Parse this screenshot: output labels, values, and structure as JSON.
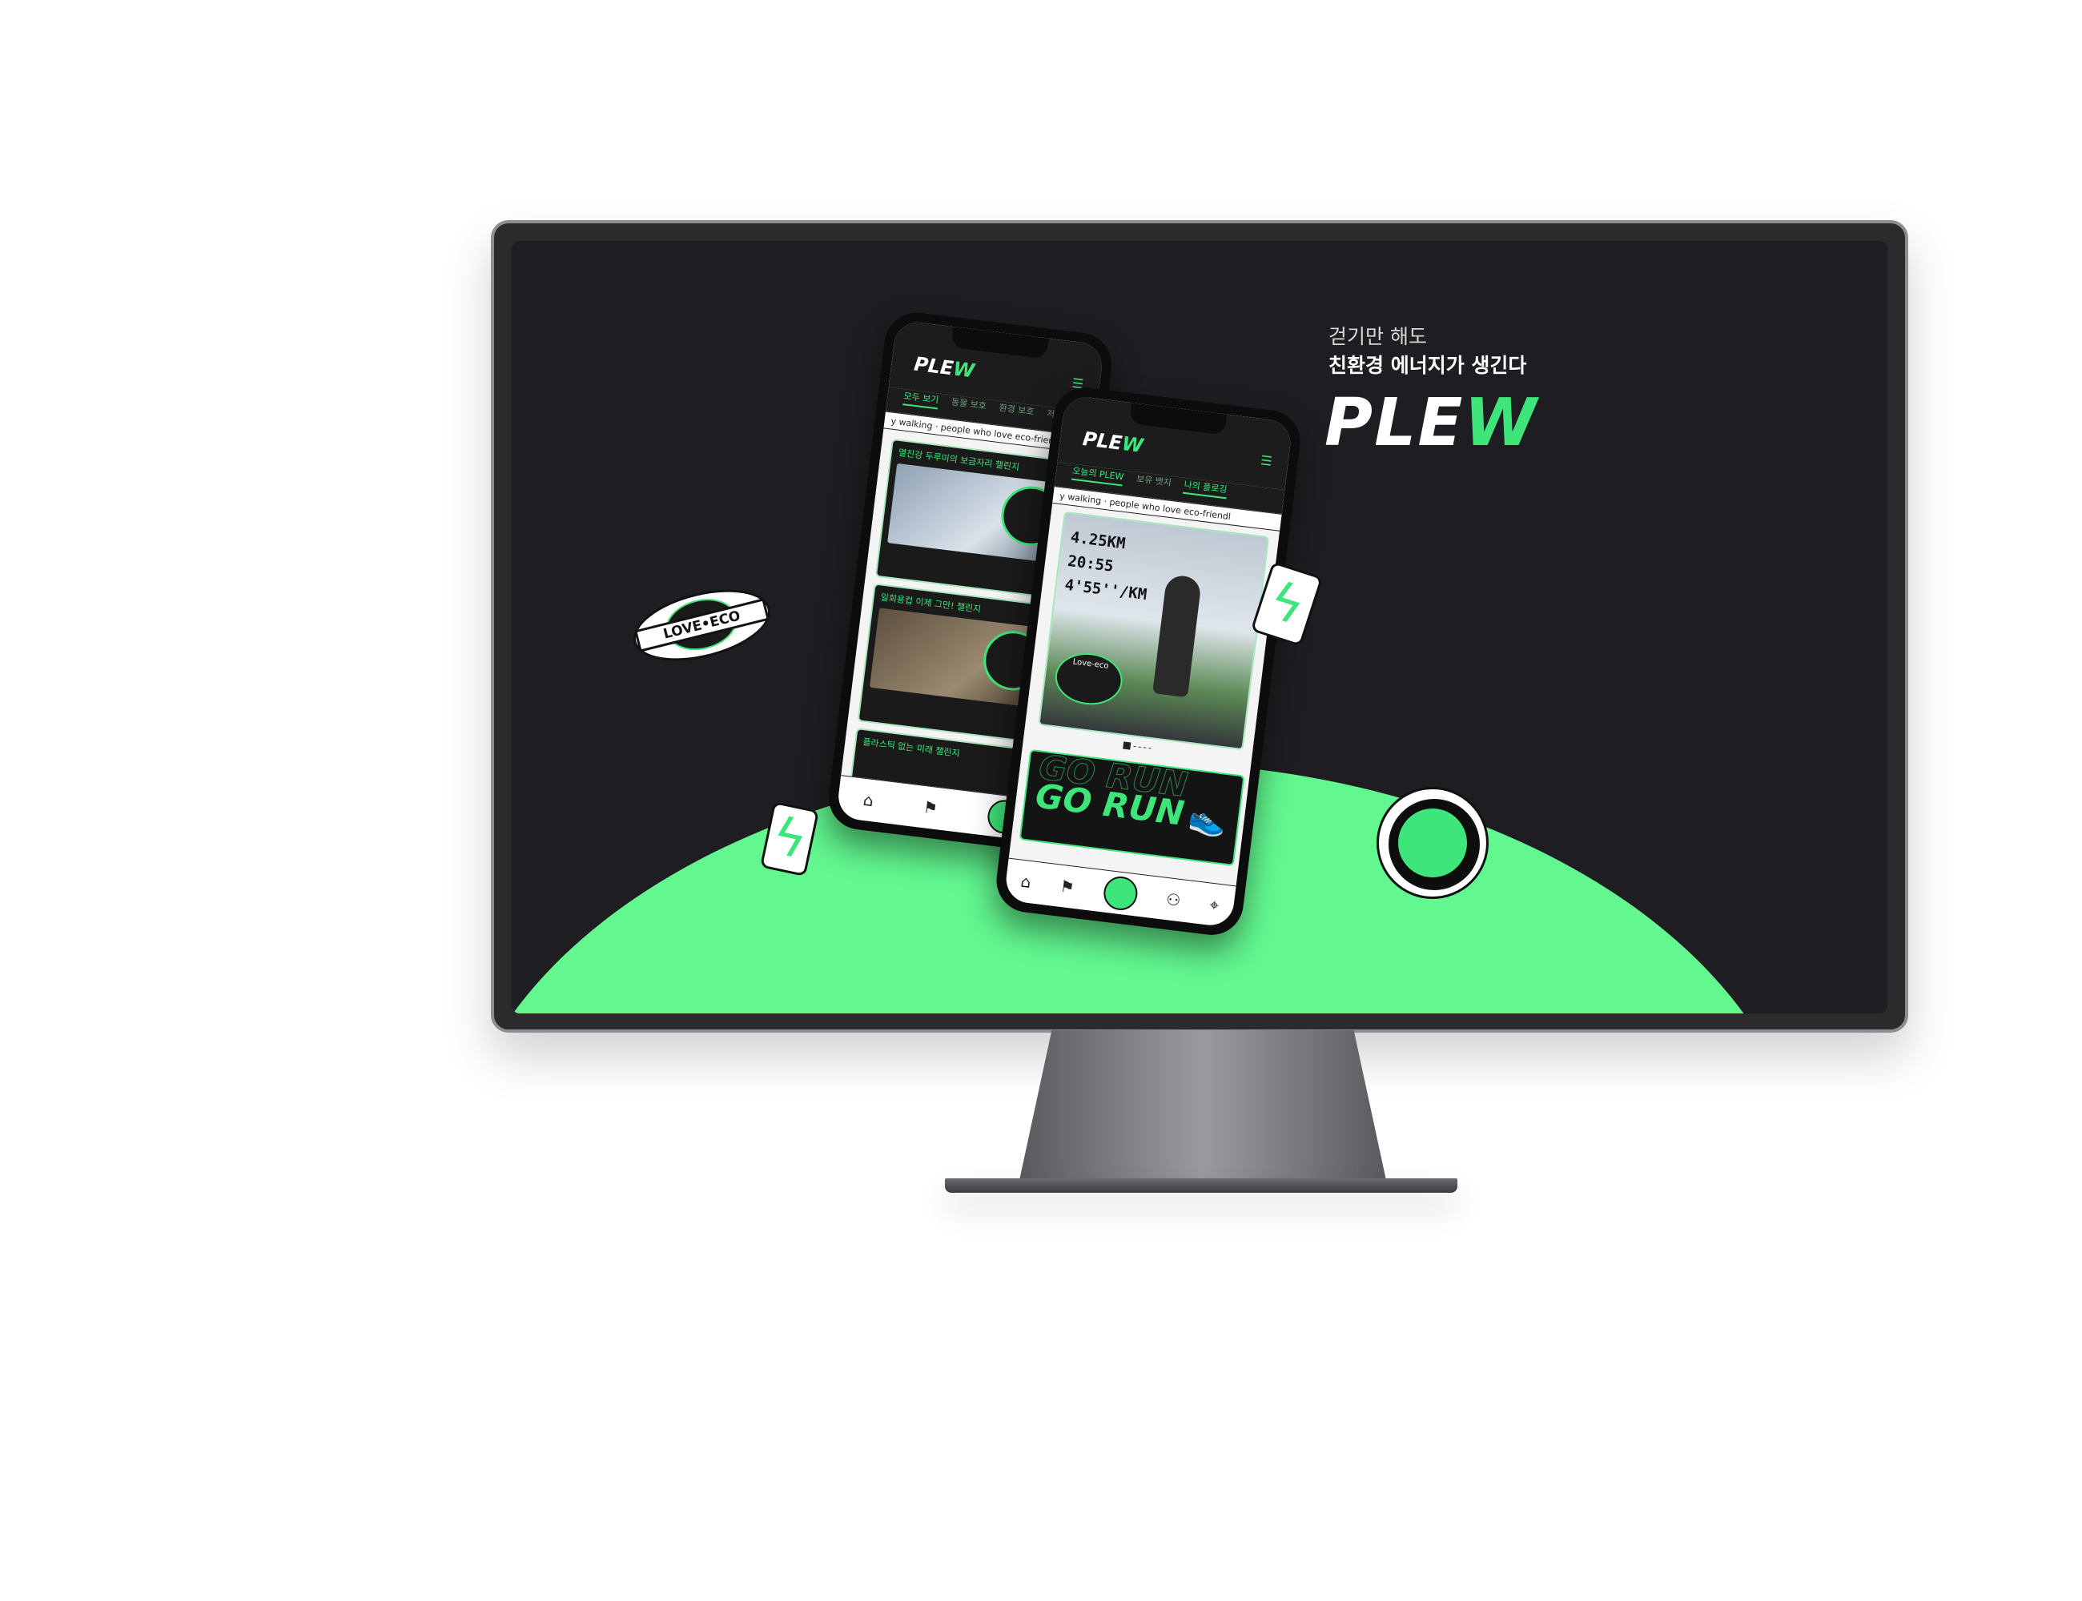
{
  "hero": {
    "subline": "걷기만 해도",
    "headline": "친환경 에너지가 생긴다",
    "logo_main": "PLE",
    "logo_accent": "W"
  },
  "phone_left": {
    "logo_main": "PLE",
    "logo_accent": "W",
    "tabs": [
      "모두 보기",
      "동물 보호",
      "환경 보호",
      "저소득"
    ],
    "ticker": "y walking · people who love eco-friendl",
    "cards": [
      {
        "title": "멸진강 두루미의 보금자리 챌린지"
      },
      {
        "title": "일회용컵 이제 그만! 챌린지"
      },
      {
        "title": "플라스틱 없는 미래 챌린지"
      }
    ]
  },
  "phone_right": {
    "logo_main": "PLE",
    "logo_accent": "W",
    "tabs": [
      "오늘의 PLEW",
      "보유 뱃지",
      "나의 플로깅"
    ],
    "ticker": "y walking · people who love eco-friendl",
    "stats": {
      "distance": "4.25KM",
      "time": "20:55",
      "pace": "4'55''/KM"
    },
    "badge_label": "Love-eco",
    "pager": "■----",
    "cta": "GO RUN"
  },
  "stickers": {
    "love_eco": "LOVE•ECO"
  },
  "icons": {
    "menu": "menu-icon",
    "bolt": "lightning-bolt-icon",
    "globe": "globe-icon",
    "shoe": "sneaker-icon"
  },
  "colors": {
    "accent": "#3ee57a",
    "screen_bg": "#1e1d21",
    "dome": "#62f78f"
  }
}
